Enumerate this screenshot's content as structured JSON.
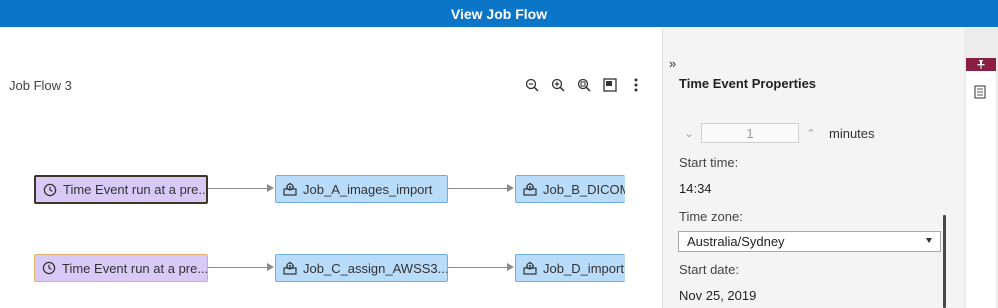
{
  "window": {
    "title": "View Job Flow"
  },
  "flow": {
    "name": "Job Flow 3",
    "toolbar": [
      "zoom-out-icon",
      "zoom-in-icon",
      "zoom-fit-icon",
      "overview-icon",
      "more-options-icon"
    ],
    "nodes": {
      "time_event_1": "Time Event run at a pre...",
      "job_a": "Job_A_images_import",
      "job_b": "Job_B_DICOM",
      "time_event_2": "Time Event run at a pre...",
      "job_c": "Job_C_assign_AWSS3...",
      "job_d": "Job_D_import"
    }
  },
  "panel": {
    "collapse_glyph": "»",
    "title": "Time Event Properties",
    "interval": {
      "value": "1",
      "unit": "minutes"
    },
    "start_time": {
      "label": "Start time:",
      "value": "14:34"
    },
    "time_zone": {
      "label": "Time zone:",
      "value": "Australia/Sydney"
    },
    "start_date": {
      "label": "Start date:",
      "value": "Nov 25, 2019"
    }
  },
  "colors": {
    "title_bar": "#0b76c8",
    "time_event_fill": "#d9c9f6",
    "job_fill": "#b9dcfa",
    "pin_tab": "#8a1e45"
  }
}
